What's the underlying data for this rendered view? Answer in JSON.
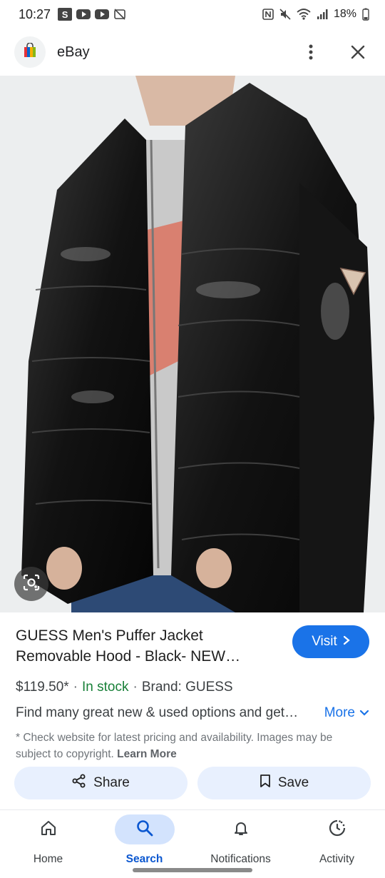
{
  "status_bar": {
    "time": "10:27",
    "notif_badge": "S",
    "battery": "18%"
  },
  "header": {
    "site_name": "eBay",
    "favicon": "shopping-bag-icon",
    "menu_icon": "more-vert-icon",
    "close_icon": "close-icon"
  },
  "image": {
    "lens_icon": "lens-icon"
  },
  "product": {
    "title": "GUESS Men's Puffer Jacket Removable Hood - Black- NEW…",
    "visit_label": "Visit",
    "price": "$119.50*",
    "stock": "In stock",
    "brand": "Brand: GUESS",
    "description": "Find many great new & used options and get…",
    "more_label": "More",
    "disclaimer": "* Check website for latest pricing and availability. Images may be subject to copyright.",
    "learn_more": "Learn More"
  },
  "actions": {
    "share_label": "Share",
    "save_label": "Save"
  },
  "nav": [
    {
      "label": "Home",
      "icon": "home-icon",
      "active": false
    },
    {
      "label": "Search",
      "icon": "search-icon",
      "active": true
    },
    {
      "label": "Notifications",
      "icon": "bell-icon",
      "active": false
    },
    {
      "label": "Activity",
      "icon": "activity-icon",
      "active": false
    }
  ],
  "colors": {
    "accent": "#1a73e8",
    "in_stock": "#188038",
    "pill_bg": "#e8f0fe",
    "nav_active_bg": "#d3e3fd"
  }
}
